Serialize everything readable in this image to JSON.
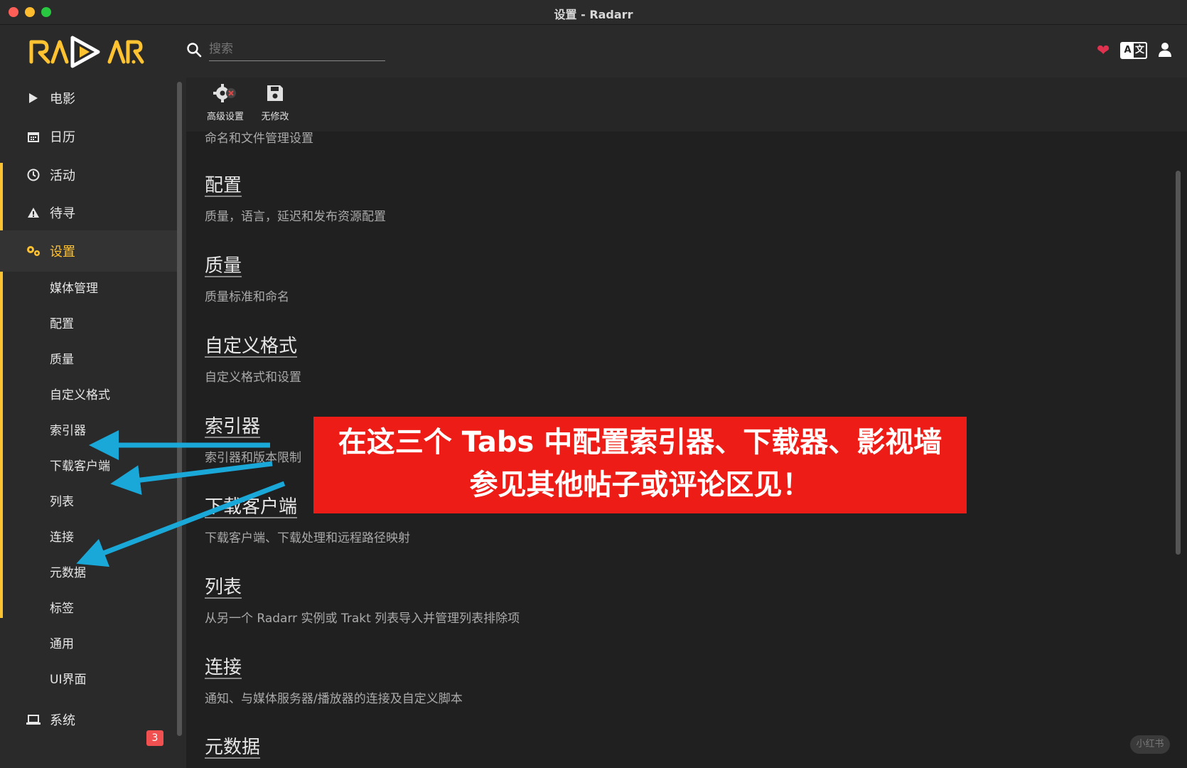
{
  "window": {
    "title": "设置 - Radarr"
  },
  "header": {
    "search_placeholder": "搜索"
  },
  "sidebar": {
    "items": [
      {
        "label": "电影",
        "icon": "play-icon"
      },
      {
        "label": "日历",
        "icon": "calendar-icon"
      },
      {
        "label": "活动",
        "icon": "clock-icon"
      },
      {
        "label": "待寻",
        "icon": "warning-icon"
      },
      {
        "label": "设置",
        "icon": "gears-icon",
        "active": true
      }
    ],
    "sub_items": [
      "媒体管理",
      "配置",
      "质量",
      "自定义格式",
      "索引器",
      "下载客户端",
      "列表",
      "连接",
      "元数据",
      "标签",
      "通用",
      "UI界面"
    ],
    "system": {
      "label": "系统",
      "badge": "3"
    }
  },
  "toolbar": {
    "advanced_label": "高级设置",
    "save_label": "无修改"
  },
  "sections": [
    {
      "title": "",
      "desc": "命名和文件管理设置"
    },
    {
      "title": "配置",
      "desc": "质量，语言，延迟和发布资源配置"
    },
    {
      "title": "质量",
      "desc": "质量标准和命名"
    },
    {
      "title": "自定义格式",
      "desc": "自定义格式和设置"
    },
    {
      "title": "索引器",
      "desc": "索引器和版本限制"
    },
    {
      "title": "下载客户端",
      "desc": "下载客户端、下载处理和远程路径映射"
    },
    {
      "title": "列表",
      "desc": "从另一个 Radarr 实例或 Trakt 列表导入并管理列表排除项"
    },
    {
      "title": "连接",
      "desc": "通知、与媒体服务器/播放器的连接及自定义脚本"
    },
    {
      "title": "元数据",
      "desc": ""
    }
  ],
  "annotation": {
    "line1": "在这三个 Tabs 中配置索引器、下载器、影视墙",
    "line2": "参见其他帖子或评论区见！",
    "arrow_color": "#1aa8d8",
    "banner_color": "#ed1c16"
  },
  "watermark": "小红书",
  "colors": {
    "accent": "#ffc230",
    "badge": "#f05050",
    "heart": "#e0324e"
  }
}
